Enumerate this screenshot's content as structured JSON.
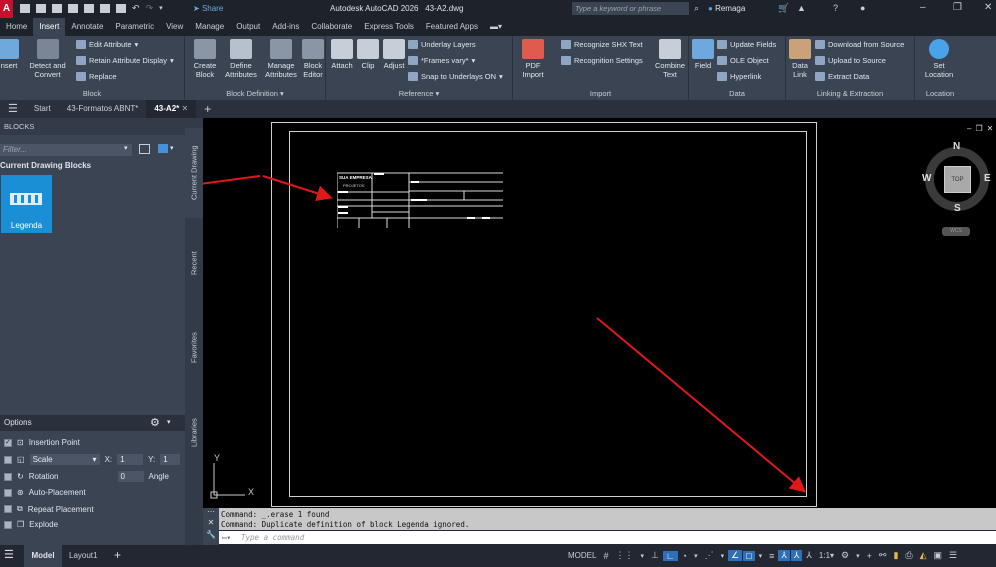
{
  "titlebar": {
    "app_title": "Autodesk AutoCAD 2026",
    "file_name": "43-A2.dwg",
    "share_label": "Share",
    "search_placeholder": "Type a keyword or phrase",
    "user": "Remaga",
    "logo_letter": "A"
  },
  "ribbon_tabs": [
    "Home",
    "Insert",
    "Annotate",
    "Parametric",
    "View",
    "Manage",
    "Output",
    "Add-ins",
    "Collaborate",
    "Express Tools",
    "Featured Apps"
  ],
  "active_ribbon_tab": "Insert",
  "ribbon": {
    "block": {
      "title": "Block",
      "insert": "Insert",
      "detect": "Detect and Convert",
      "edit_attribute": "Edit Attribute",
      "retain": "Retain Attribute Display",
      "replace": "Replace"
    },
    "block_definition": {
      "title": "Block Definition",
      "create": "Create Block",
      "define": "Define Attributes",
      "manage": "Manage Attributes",
      "editor": "Block Editor"
    },
    "reference": {
      "title": "Reference",
      "attach": "Attach",
      "clip": "Clip",
      "adjust": "Adjust",
      "underlay_layers": "Underlay Layers",
      "frames": "*Frames vary*",
      "snap": "Snap to Underlays ON"
    },
    "import": {
      "title": "Import",
      "pdf": "PDF Import",
      "recognize": "Recognize SHX Text",
      "recognition": "Recognition Settings",
      "combine": "Combine Text"
    },
    "data": {
      "title": "Data",
      "field": "Field",
      "update": "Update Fields",
      "ole": "OLE Object",
      "hyperlink": "Hyperlink"
    },
    "linking": {
      "title": "Linking & Extraction",
      "data_link": "Data Link",
      "download": "Download from Source",
      "upload": "Upload to Source",
      "extract": "Extract  Data"
    },
    "location": {
      "title": "Location",
      "set": "Set Location"
    }
  },
  "file_tabs": [
    "Start",
    "43-Formatos ABNT*",
    "43-A2*"
  ],
  "active_file_tab": "43-A2*",
  "palette": {
    "title": "BLOCKS",
    "filter_placeholder": "Filter...",
    "section": "Current Drawing Blocks",
    "block_name": "Legenda",
    "vertical_tabs": [
      "Current Drawing",
      "Recent",
      "Favorites",
      "Libraries"
    ],
    "options_title": "Options",
    "options": {
      "insertion_point": "Insertion Point",
      "scale_mode": "Scale",
      "x_label": "X:",
      "x_value": "1",
      "y_label": "Y:",
      "y_value": "1",
      "rotation": "Rotation",
      "rotation_value": "0",
      "angle_label": "Angle",
      "auto_placement": "Auto-Placement",
      "repeat_placement": "Repeat Placement",
      "explode": "Explode"
    },
    "insertion_point_checked": true
  },
  "drawing": {
    "title_block": {
      "company": "SUA EMPRESA",
      "projects": "PROJETOS"
    },
    "ucs_x": "X",
    "ucs_y": "Y"
  },
  "viewcube": {
    "n": "N",
    "s": "S",
    "e": "E",
    "w": "W",
    "face": "TOP",
    "wcs": "WCS"
  },
  "command": {
    "history": [
      "Command: _.erase 1 found",
      "Command: Duplicate definition of block Legenda  ignored."
    ],
    "placeholder": "Type a command"
  },
  "layout_tabs": [
    "Model",
    "Layout1"
  ],
  "status": {
    "model": "MODEL",
    "scale": "1:1"
  },
  "colors": {
    "accent": "#2f8fd8",
    "arrow": "#e01818",
    "ribbon_bg": "#3b4453"
  }
}
